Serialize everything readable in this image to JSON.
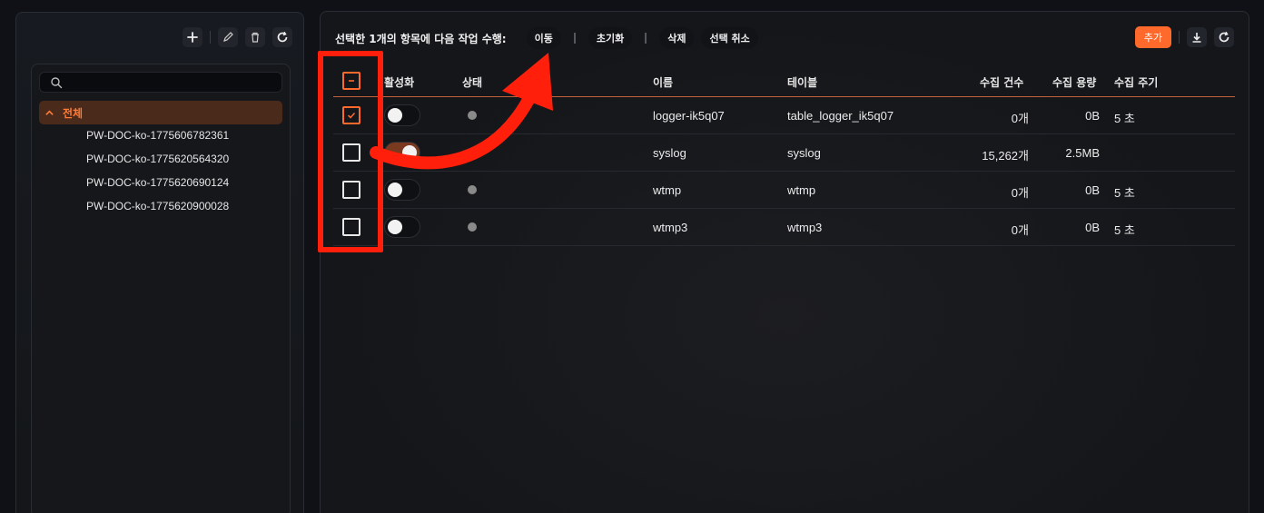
{
  "sidebar": {
    "search": {
      "placeholder": "",
      "value": ""
    },
    "root_label": "전체",
    "items": [
      "PW-DOC-ko-1775606782361",
      "PW-DOC-ko-1775620564320",
      "PW-DOC-ko-1775620690124",
      "PW-DOC-ko-1775620900028"
    ]
  },
  "action_bar": {
    "text": "선택한 1개의 항목에 다음 작업 수행:",
    "buttons": [
      "이동",
      "초기화",
      "삭제",
      "선택 취소"
    ]
  },
  "toolbar": {
    "add_label": "추가"
  },
  "table": {
    "headers": {
      "active": "활성화",
      "status": "상태",
      "name": "이름",
      "table": "테이블",
      "count": "수집 건수",
      "size": "수집 용량",
      "interval": "수집 주기"
    },
    "rows": [
      {
        "checked": true,
        "active": false,
        "name": "logger-ik5q07",
        "table": "table_logger_ik5q07",
        "count": "0개",
        "size": "0B",
        "interval": "5 초"
      },
      {
        "checked": false,
        "active": true,
        "name": "syslog",
        "table": "syslog",
        "count": "15,262개",
        "size": "2.5MB",
        "interval": ""
      },
      {
        "checked": false,
        "active": false,
        "name": "wtmp",
        "table": "wtmp",
        "count": "0개",
        "size": "0B",
        "interval": "5 초"
      },
      {
        "checked": false,
        "active": false,
        "name": "wtmp3",
        "table": "wtmp3",
        "count": "0개",
        "size": "0B",
        "interval": "5 초"
      }
    ]
  },
  "colors": {
    "accent": "#ff6a2c",
    "annotation": "#ff1f0a"
  },
  "icons": [
    "plus-icon",
    "pencil-icon",
    "trash-icon",
    "refresh-icon",
    "search-icon",
    "chevron-up-icon",
    "download-icon",
    "check-icon",
    "minus-icon"
  ]
}
